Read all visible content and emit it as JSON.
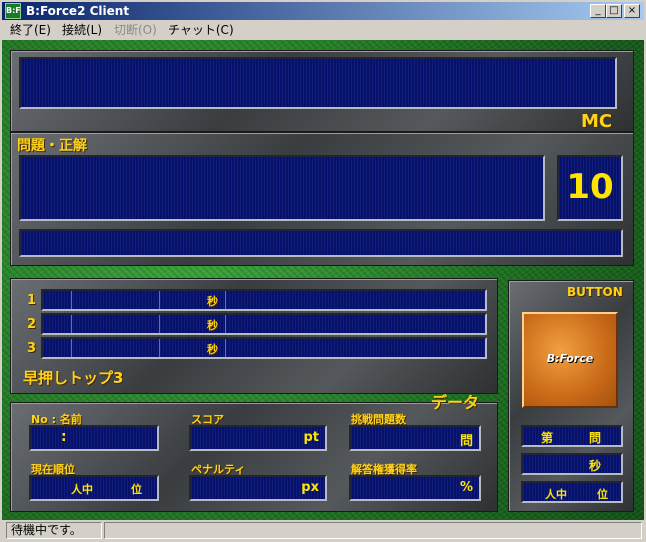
{
  "window": {
    "title": "B:Force2 Client",
    "icon_text": "B:F",
    "minimize": "_",
    "maximize": "□",
    "close": "×"
  },
  "menu": [
    {
      "label": "終了(E)",
      "enabled": true
    },
    {
      "label": "接続(L)",
      "enabled": true
    },
    {
      "label": "切断(O)",
      "enabled": false
    },
    {
      "label": "チャット(C)",
      "enabled": true
    }
  ],
  "mc": {
    "label": "MC"
  },
  "question": {
    "label": "問題・正解",
    "timer": "10"
  },
  "top3": {
    "label": "早押しトップ3",
    "rows": [
      {
        "rank": "1",
        "sec_unit": "秒"
      },
      {
        "rank": "2",
        "sec_unit": "秒"
      },
      {
        "rank": "3",
        "sec_unit": "秒"
      }
    ]
  },
  "data": {
    "label": "データ",
    "no_name_label": "No : 名前",
    "no_name_value": ":",
    "score_label": "スコア",
    "score_unit": "pt",
    "challenge_label": "挑戦問題数",
    "challenge_unit": "問",
    "rank_label": "現在順位",
    "rank_people": "人中",
    "rank_unit": "位",
    "penalty_label": "ペナルティ",
    "penalty_unit": "px",
    "rate_label": "解答権獲得率",
    "rate_unit": "%"
  },
  "button_panel": {
    "label": "BUTTON",
    "buzzer_text": "B:Force",
    "q_prefix": "第",
    "q_unit": "問",
    "sec_unit": "秒",
    "rank_people": "人中",
    "rank_unit": "位"
  },
  "status": {
    "text": "待機中です。"
  }
}
